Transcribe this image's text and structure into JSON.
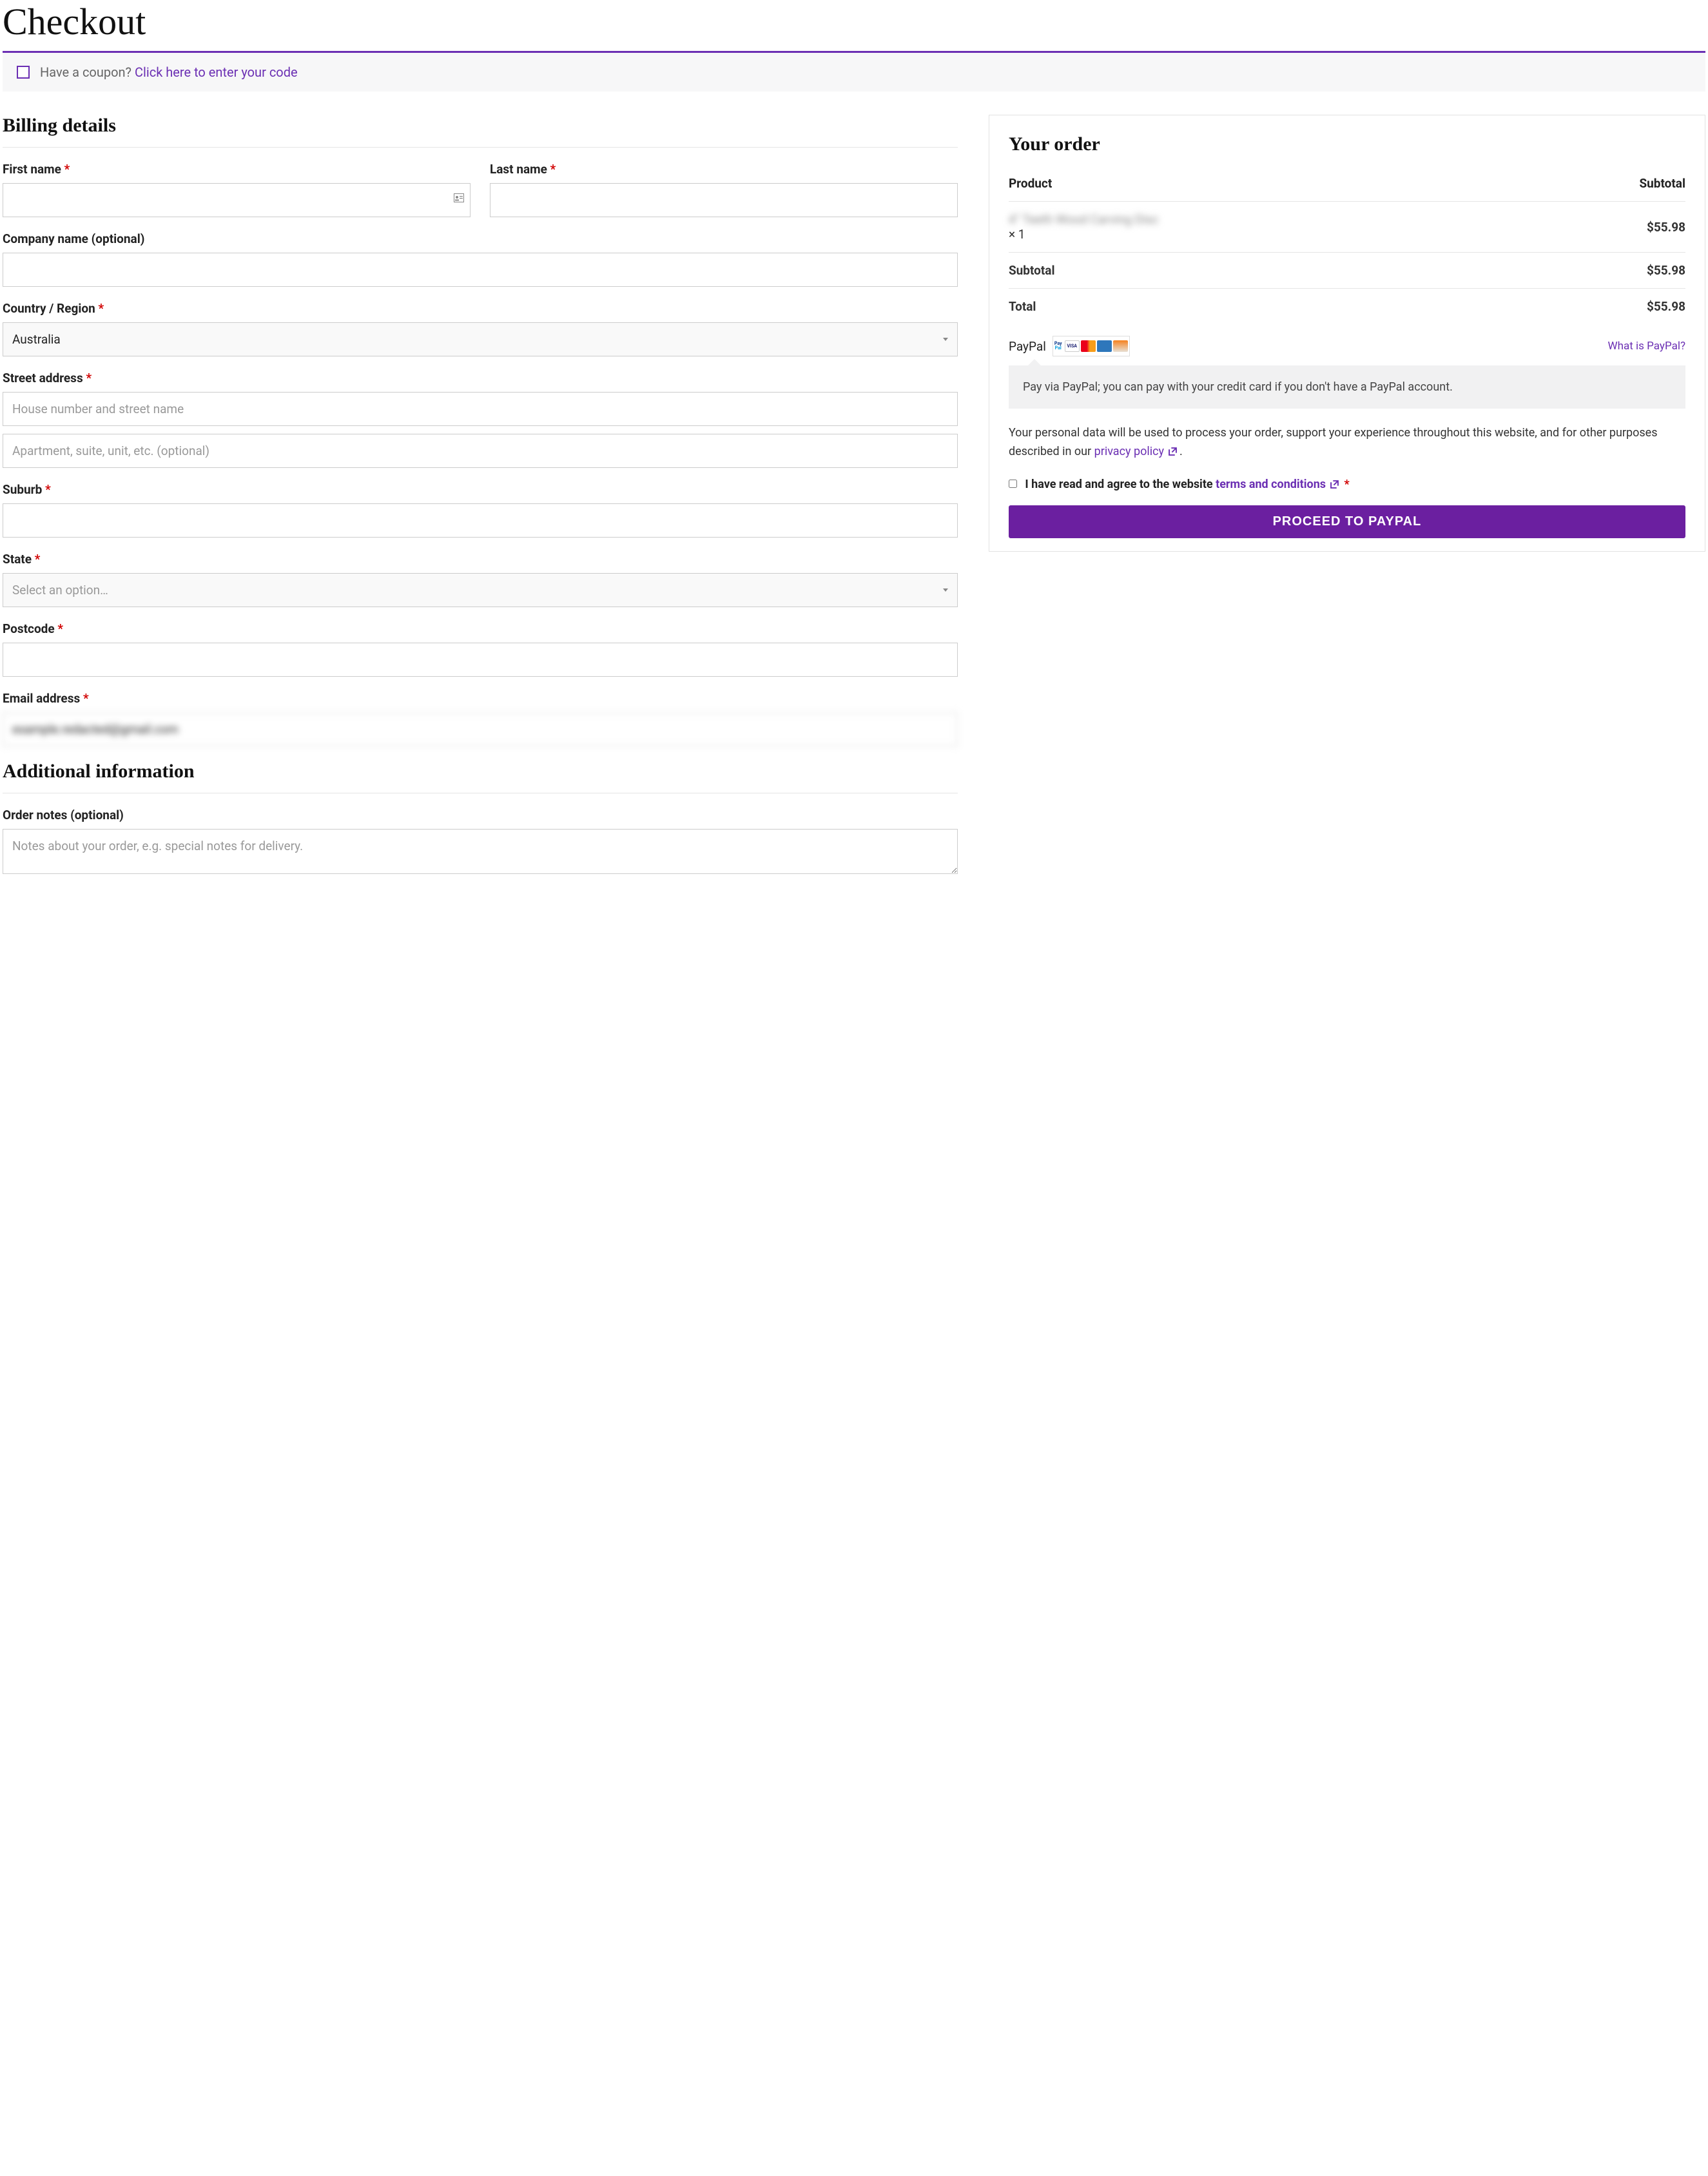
{
  "page_title": "Checkout",
  "coupon": {
    "question": "Have a coupon?",
    "link": "Click here to enter your code"
  },
  "billing": {
    "heading": "Billing details",
    "first_name_label": "First name",
    "last_name_label": "Last name",
    "company_label": "Company name (optional)",
    "country_label": "Country / Region",
    "country_value": "Australia",
    "street_label": "Street address",
    "street_placeholder": "House number and street name",
    "street2_placeholder": "Apartment, suite, unit, etc. (optional)",
    "suburb_label": "Suburb",
    "state_label": "State",
    "state_placeholder": "Select an option…",
    "postcode_label": "Postcode",
    "email_label": "Email address",
    "email_value": "example.redacted@gmail.com"
  },
  "additional": {
    "heading": "Additional information",
    "notes_label": "Order notes (optional)",
    "notes_placeholder": "Notes about your order, e.g. special notes for delivery."
  },
  "order": {
    "heading": "Your order",
    "product_header": "Product",
    "subtotal_header": "Subtotal",
    "item_name": "4\" Teeth Wood Carving Disc",
    "item_qty": "× 1",
    "item_price": "$55.98",
    "subtotal_label": "Subtotal",
    "subtotal_value": "$55.98",
    "total_label": "Total",
    "total_value": "$55.98"
  },
  "payment": {
    "method": "PayPal",
    "whatis": "What is PayPal?",
    "description": "Pay via PayPal; you can pay with your credit card if you don't have a PayPal account."
  },
  "privacy": {
    "text": "Your personal data will be used to process your order, support your experience throughout this website, and for other purposes described in our",
    "link": "privacy policy",
    "period": "."
  },
  "terms": {
    "prefix": "I have read and agree to the website",
    "link": "terms and conditions",
    "required": "*"
  },
  "proceed_button": "PROCEED TO PAYPAL"
}
